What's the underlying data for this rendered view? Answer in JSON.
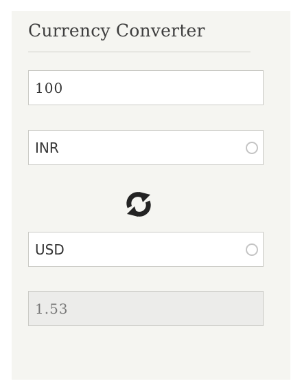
{
  "converter": {
    "title": "Currency Converter",
    "amount": "100",
    "from_currency": "INR",
    "to_currency": "USD",
    "result": "1.53"
  },
  "icons": {
    "swap": "swap-arrows-icon",
    "dropdown": "radio-circle-icon"
  },
  "colors": {
    "panel_background": "#f5f5f1",
    "field_border": "#cbcbc6",
    "result_background": "#ececea"
  }
}
